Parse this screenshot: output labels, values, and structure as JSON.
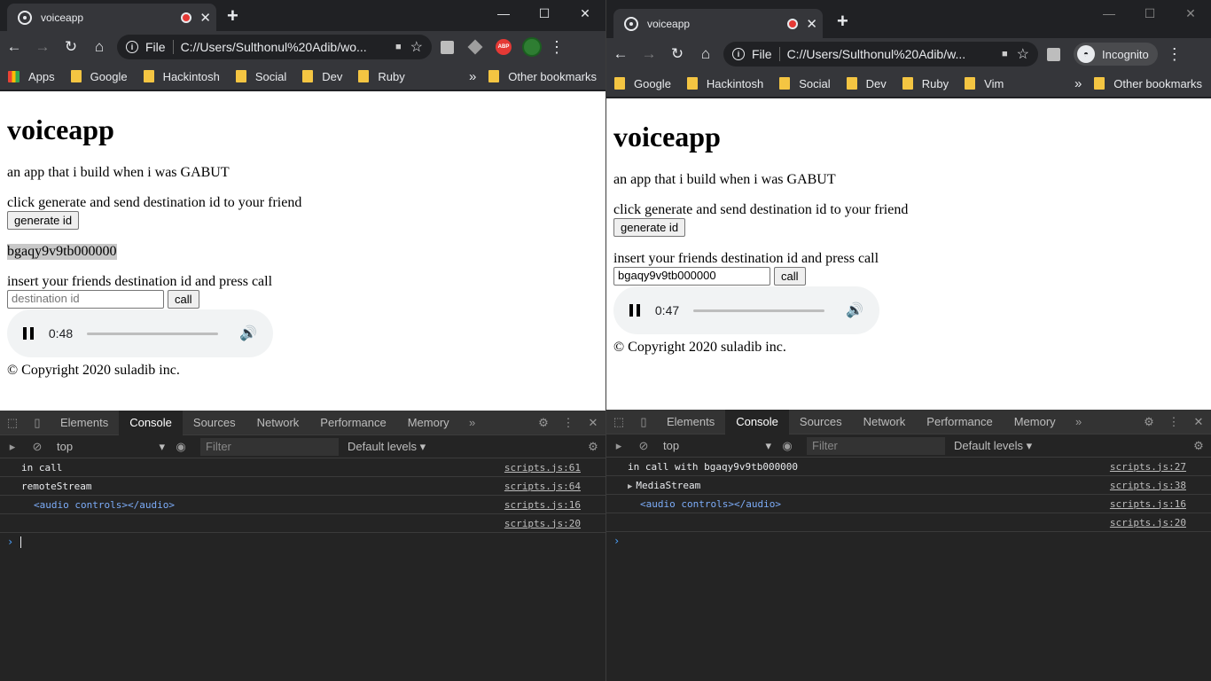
{
  "left": {
    "tab_title": "voiceapp",
    "omnibox": {
      "scheme": "File",
      "url": "C://Users/Sulthonul%20Adib/wo..."
    },
    "bookmarks": [
      "Apps",
      "Google",
      "Hackintosh",
      "Social",
      "Dev",
      "Ruby"
    ],
    "other_bookmarks": "Other bookmarks",
    "page": {
      "heading": "voiceapp",
      "tagline": "an app that i build when i was GABUT",
      "generate_text": "click generate and send destination id to your friend",
      "generate_button": "generate id",
      "generated_id": "bgaqy9v9tb000000",
      "insert_text": "insert your friends destination id and press call",
      "dest_placeholder": "destination id",
      "dest_value": "",
      "call_button": "call",
      "audio_time": "0:48",
      "copyright": "© Copyright 2020 suladib inc."
    },
    "devtools": {
      "tabs": [
        "Elements",
        "Console",
        "Sources",
        "Network",
        "Performance",
        "Memory"
      ],
      "active_tab": "Console",
      "context": "top",
      "filter_placeholder": "Filter",
      "levels": "Default levels",
      "logs": [
        {
          "msg": "in call",
          "src": "scripts.js:61"
        },
        {
          "msg": "remoteStream",
          "src": "scripts.js:64"
        },
        {
          "msg": "<audio controls></audio>",
          "src": "scripts.js:16"
        },
        {
          "msg": "",
          "src": "scripts.js:20"
        }
      ]
    }
  },
  "right": {
    "tab_title": "voiceapp",
    "omnibox": {
      "scheme": "File",
      "url": "C://Users/Sulthonul%20Adib/w..."
    },
    "incognito_label": "Incognito",
    "bookmarks": [
      "Google",
      "Hackintosh",
      "Social",
      "Dev",
      "Ruby",
      "Vim"
    ],
    "other_bookmarks": "Other bookmarks",
    "page": {
      "heading": "voiceapp",
      "tagline": "an app that i build when i was GABUT",
      "generate_text": "click generate and send destination id to your friend",
      "generate_button": "generate id",
      "insert_text": "insert your friends destination id and press call",
      "dest_value": "bgaqy9v9tb000000",
      "call_button": "call",
      "audio_time": "0:47",
      "copyright": "© Copyright 2020 suladib inc."
    },
    "devtools": {
      "tabs": [
        "Elements",
        "Console",
        "Sources",
        "Network",
        "Performance",
        "Memory"
      ],
      "active_tab": "Console",
      "context": "top",
      "filter_placeholder": "Filter",
      "levels": "Default levels",
      "logs": [
        {
          "msg": "in call with bgaqy9v9tb000000",
          "src": "scripts.js:27"
        },
        {
          "msg": "MediaStream",
          "src": "scripts.js:38"
        },
        {
          "msg": "<audio controls></audio>",
          "src": "scripts.js:16"
        },
        {
          "msg": "",
          "src": "scripts.js:20"
        }
      ]
    }
  }
}
